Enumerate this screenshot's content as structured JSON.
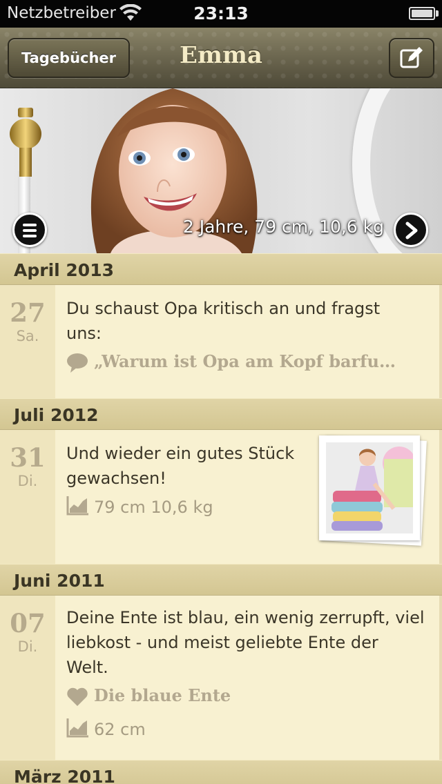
{
  "status_bar": {
    "carrier": "Netzbetreiber",
    "time": "23:13"
  },
  "nav": {
    "back_label": "Tagebücher",
    "title": "Emma"
  },
  "hero": {
    "stats": "2 Jahre, 79 cm, 10,6 kg"
  },
  "feed": [
    {
      "month": "April 2013",
      "day": "27",
      "weekday": "Sa.",
      "text": "Du schaust Opa kritisch an und fragst uns:",
      "quote": "„Warum ist Opa am Kopf barfu…"
    },
    {
      "month": "Juli 2012",
      "day": "31",
      "weekday": "Di.",
      "text": "Und wieder ein gutes Stück gewachsen!",
      "stats": "79 cm  10,6 kg"
    },
    {
      "month": "Juni 2011",
      "day": "07",
      "weekday": "Di.",
      "text": "Deine Ente ist blau, ein wenig zerrupft, viel liebkost - und meist geliebte Ente der Welt.",
      "favorite": "Die blaue Ente",
      "stats": "62 cm"
    },
    {
      "month": "März 2011"
    }
  ],
  "icons": {
    "wifi": "wifi-icon",
    "battery": "battery-icon",
    "compose": "compose-icon",
    "menu": "menu-icon",
    "next": "chevron-right-icon",
    "quote": "speech-bubble-icon",
    "growth": "growth-chart-icon",
    "heart": "heart-icon"
  }
}
